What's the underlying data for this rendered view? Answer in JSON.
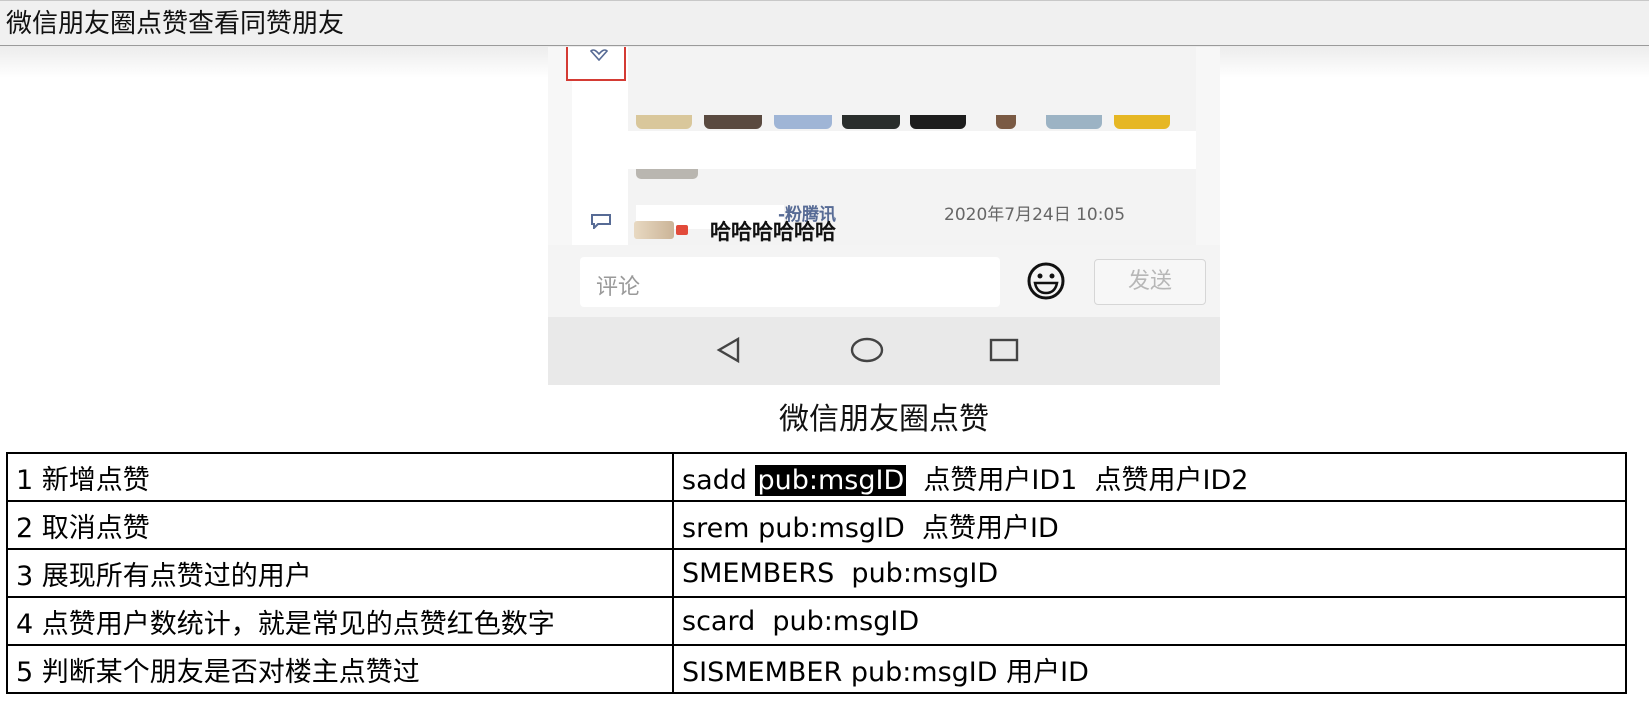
{
  "window": {
    "title": "微信朋友圈点赞查看同赞朋友"
  },
  "screenshot": {
    "post": {
      "author_suffix": "-粉腾讯",
      "timestamp": "2020年7月24日 10:05",
      "comment": "哈哈哈哈哈哈"
    },
    "comment_input": {
      "placeholder": "评论",
      "send_label": "发送"
    },
    "colors": {
      "link_blue": "#576b95",
      "highlight_red": "#d43b34"
    }
  },
  "caption": "微信朋友圈点赞",
  "table": {
    "rows": [
      {
        "op": "1 新增点赞",
        "cmd_prefix": "sadd ",
        "cmd_key": "pub:msgID",
        "cmd_suffix": "  点赞用户ID1  点赞用户ID2"
      },
      {
        "op": "2 取消点赞",
        "cmd": "srem pub:msgID  点赞用户ID"
      },
      {
        "op": "3 展现所有点赞过的用户",
        "cmd": "SMEMBERS  pub:msgID"
      },
      {
        "op": "4 点赞用户数统计，就是常见的点赞红色数字",
        "cmd": "scard  pub:msgID"
      },
      {
        "op": "5 判断某个朋友是否对楼主点赞过",
        "cmd": "SISMEMBER pub:msgID 用户ID"
      }
    ]
  }
}
